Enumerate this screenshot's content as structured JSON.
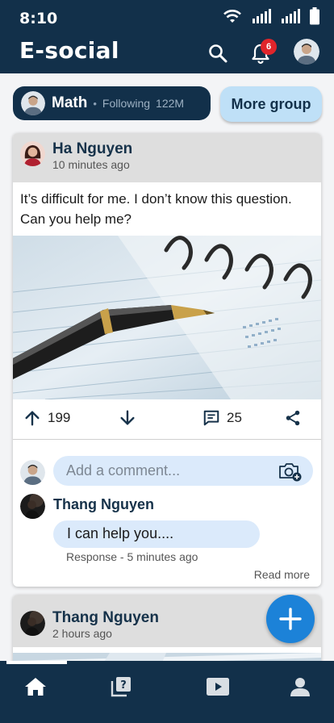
{
  "status_bar": {
    "time": "8:10"
  },
  "header": {
    "title": "E-social",
    "notification_count": "6",
    "icons": [
      "search-icon",
      "bell-icon",
      "avatar"
    ]
  },
  "group": {
    "name": "Math",
    "separator": "•",
    "following_label": "Following",
    "followers": "122M",
    "more_label": "More group"
  },
  "post": {
    "author": "Ha Nguyen",
    "time": "10 minutes ago",
    "text": "It’s difficult for me. I don’t know this question. Can you help me?",
    "upvotes": "199",
    "comments": "25",
    "comment_placeholder": "Add a comment...",
    "comment": {
      "author": "Thang Nguyen",
      "text": "I can help you....",
      "meta": "Response - 5 minutes ago"
    },
    "read_more": "Read more"
  },
  "post2": {
    "author": "Thang Nguyen",
    "time": "2 hours ago"
  },
  "bottom_nav": {
    "items": [
      "home-icon",
      "question-icon",
      "video-icon",
      "profile-icon"
    ],
    "active": "home-icon"
  },
  "colors": {
    "primary": "#12304a",
    "accent": "#1c82d8",
    "light_blue": "#bfe0f7",
    "badge": "#e0252b"
  }
}
